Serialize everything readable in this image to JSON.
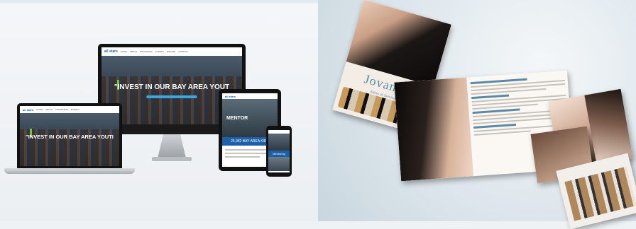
{
  "left_panel": {
    "site": {
      "logo": "all stars",
      "nav_items": [
        "HOME",
        "ABOUT",
        "PROGRAMS",
        "EVENTS",
        "DONATE",
        "CONTACT"
      ],
      "hero_text_desktop": "\"INVEST IN OUR BAY AREA YOUT",
      "hero_text_laptop": "\"INVEST IN OUR BAY AREA YOUTI",
      "tablet_title": "MENTOR",
      "tablet_banner": "25,382 BAY AREA KIDS",
      "phone_banner": "Mentoring"
    }
  },
  "right_panel": {
    "brochure_brand": "Jovance",
    "brochure_tagline": "Menu of Services",
    "colors": {
      "brand_blue": "#5a8aa8",
      "site_blue": "#1d5fa8",
      "accent_green": "#7ac143"
    }
  }
}
